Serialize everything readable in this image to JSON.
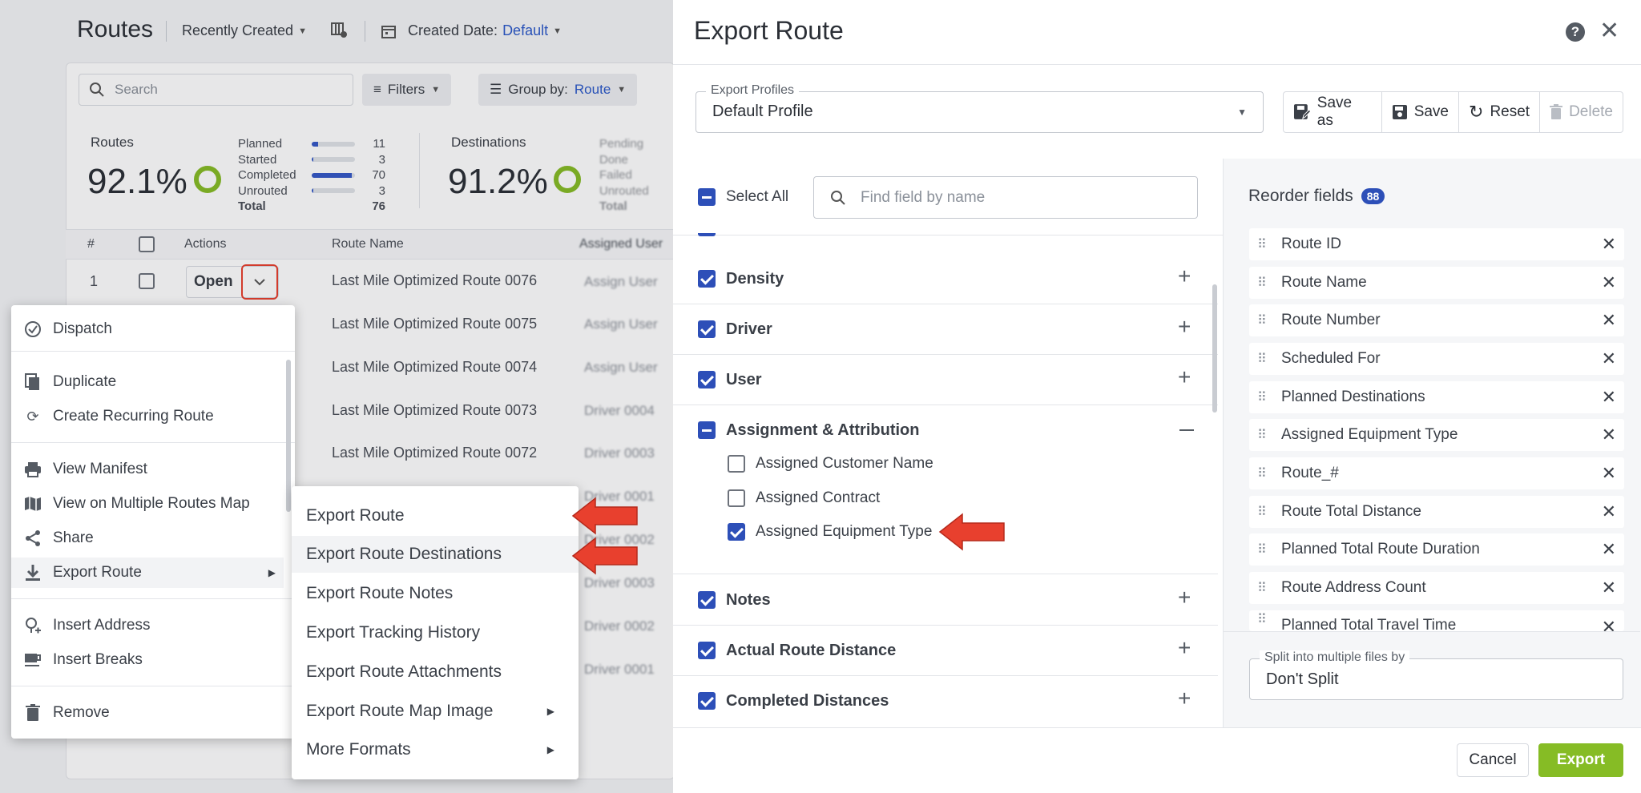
{
  "routes_page": {
    "title": "Routes",
    "sort": "Recently Created",
    "date_filter_label": "Created Date:",
    "date_filter_value": "Default",
    "search_placeholder": "Search",
    "filters_label": "Filters",
    "group_by_label": "Group by:",
    "group_by_value": "Route",
    "routes_stat": {
      "label": "Routes",
      "percent": "92.1%",
      "rows": [
        {
          "label": "Planned",
          "value": "11",
          "fraction": 0.14
        },
        {
          "label": "Started",
          "value": "3",
          "fraction": 0.04
        },
        {
          "label": "Completed",
          "value": "70",
          "fraction": 0.92
        },
        {
          "label": "Unrouted",
          "value": "3",
          "fraction": 0.04
        }
      ],
      "total_label": "Total",
      "total_value": "76"
    },
    "dest_stat": {
      "label": "Destinations",
      "percent": "91.2%",
      "rows": [
        "Pending",
        "Done",
        "Failed",
        "Unrouted"
      ],
      "total_label": "Total"
    },
    "table_headers": {
      "num": "#",
      "actions": "Actions",
      "route_name": "Route Name",
      "assigned_user": "Assigned User"
    },
    "row1": {
      "num": "1",
      "open": "Open"
    },
    "route_names": [
      "Last Mile Optimized Route 0076",
      "Last Mile Optimized Route 0075",
      "Last Mile Optimized Route 0074",
      "Last Mile Optimized Route 0073",
      "Last Mile Optimized Route 0072"
    ],
    "assigned": [
      "Assign User",
      "Assign User",
      "Assign User",
      "Driver 0004",
      "Driver 0003",
      "Driver 0001",
      "Driver 0002",
      "Driver 0003",
      "Driver 0002",
      "Driver 0001"
    ]
  },
  "context_menu": {
    "dispatch": "Dispatch",
    "duplicate": "Duplicate",
    "create_recurring": "Create Recurring Route",
    "view_manifest": "View Manifest",
    "view_map": "View on Multiple Routes Map",
    "share": "Share",
    "export_route": "Export Route",
    "insert_address": "Insert Address",
    "insert_breaks": "Insert Breaks",
    "remove": "Remove"
  },
  "submenu": {
    "items": [
      "Export Route",
      "Export Route Destinations",
      "Export Route Notes",
      "Export Tracking History",
      "Export Route Attachments",
      "Export Route Map Image",
      "More Formats"
    ]
  },
  "modal": {
    "title": "Export Route",
    "profiles_legend": "Export Profiles",
    "profile_value": "Default Profile",
    "save_as": "Save as",
    "save": "Save",
    "reset": "Reset",
    "delete": "Delete",
    "select_all": "Select All",
    "find_placeholder": "Find field by name",
    "groups": {
      "density": "Density",
      "driver": "Driver",
      "user": "User",
      "assignment": "Assignment & Attribution",
      "notes": "Notes",
      "actual_distance": "Actual Route Distance",
      "completed_distances": "Completed Distances"
    },
    "assignment_fields": {
      "customer_name": "Assigned Customer Name",
      "contract": "Assigned Contract",
      "equipment_type": "Assigned Equipment Type"
    },
    "reorder_title": "Reorder fields",
    "reorder_count": "88",
    "reorder_fields": [
      "Route ID",
      "Route Name",
      "Route Number",
      "Scheduled For",
      "Planned Destinations",
      "Assigned Equipment Type",
      "Route_#",
      "Route Total Distance",
      "Planned Total Route Duration",
      "Route Address Count",
      "Planned Total Travel Time"
    ],
    "split_legend": "Split into multiple files by",
    "split_value": "Don't Split",
    "cancel": "Cancel",
    "export": "Export"
  },
  "colors": {
    "accent": "#2d4fb8",
    "export_button": "#86bc25",
    "highlight_arrow": "#e8402e"
  }
}
